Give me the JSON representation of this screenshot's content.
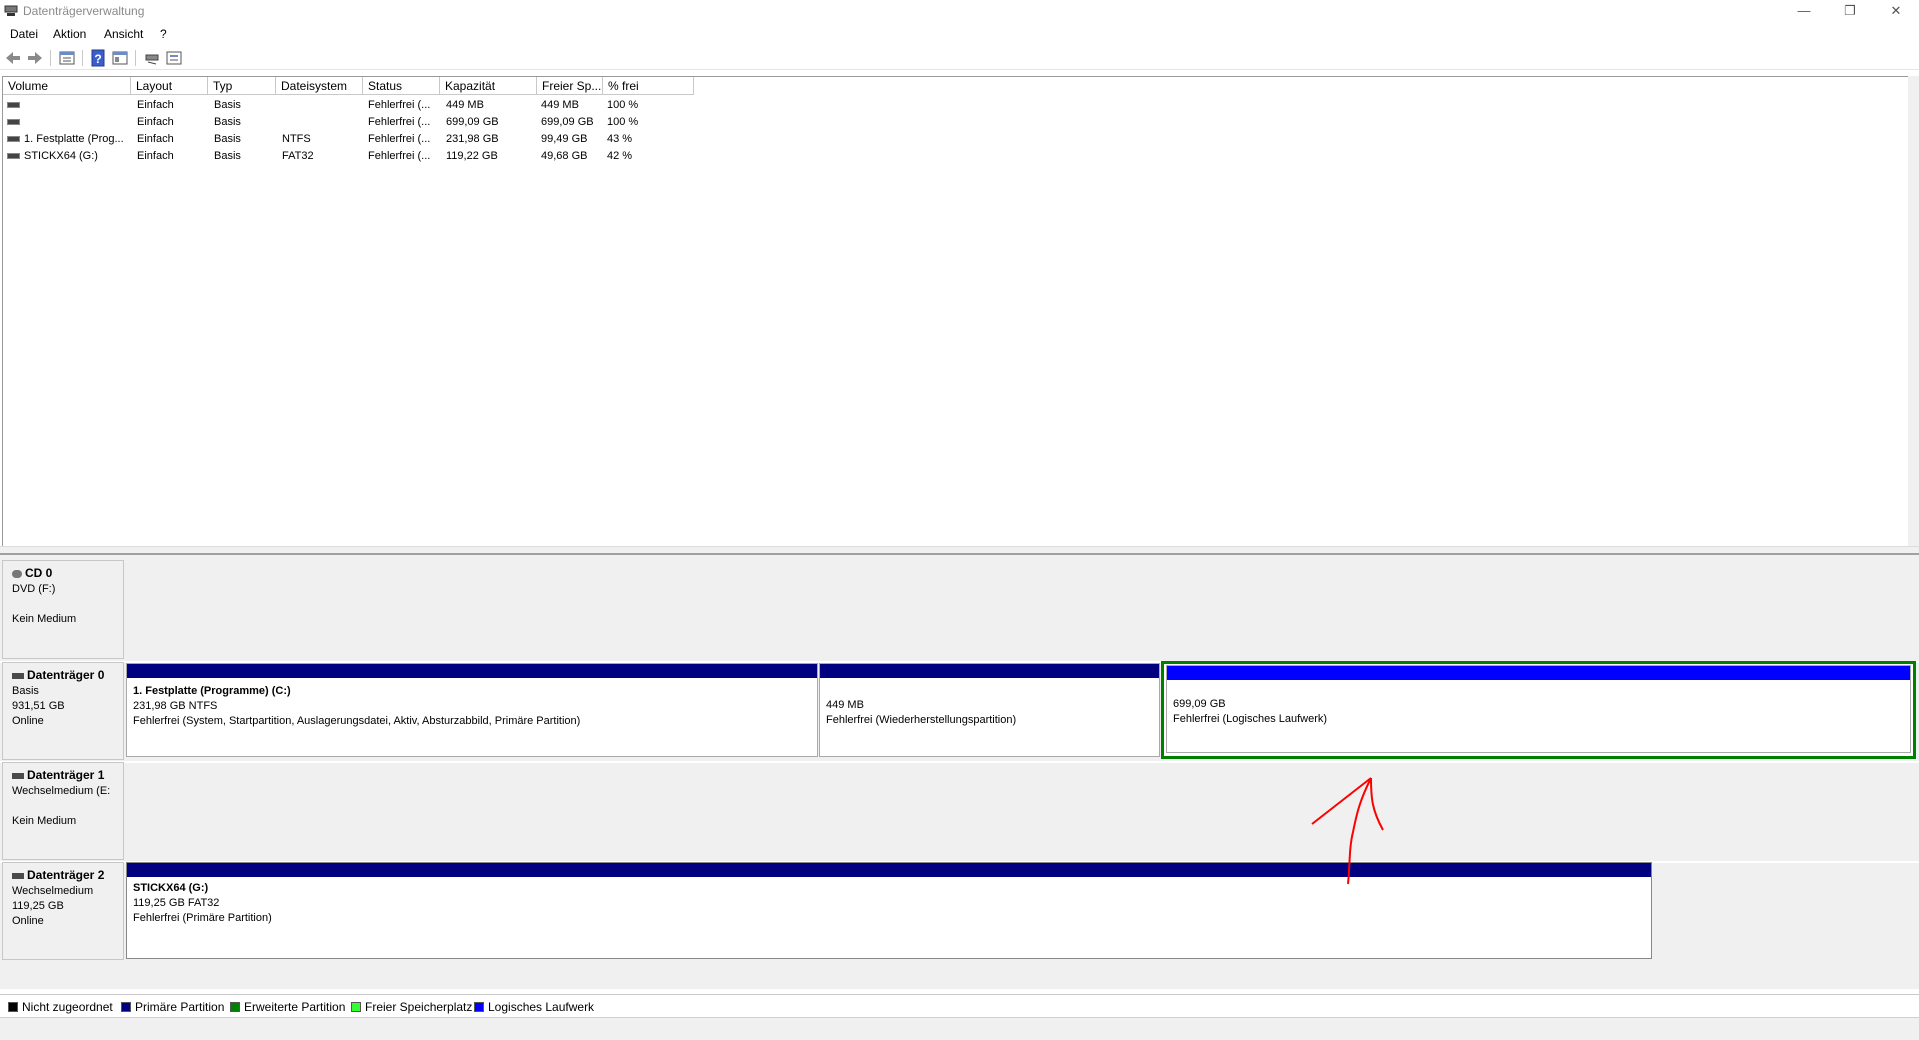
{
  "window": {
    "title": "Datenträgerverwaltung",
    "controls": {
      "minimize": "—",
      "restore": "❐",
      "close": "✕"
    }
  },
  "menu": {
    "items": [
      "Datei",
      "Aktion",
      "Ansicht",
      "?"
    ]
  },
  "toolbar": {
    "icons": [
      "back-arrow-icon",
      "forward-arrow-icon",
      "properties-icon",
      "help-icon",
      "view-icon",
      "connect-icon",
      "list-icon"
    ]
  },
  "volume_list": {
    "columns": [
      "Volume",
      "Layout",
      "Typ",
      "Dateisystem",
      "Status",
      "Kapazität",
      "Freier Sp...",
      "% frei"
    ],
    "rows": [
      [
        "",
        "Einfach",
        "Basis",
        "",
        "Fehlerfrei (...",
        "449 MB",
        "449 MB",
        "100 %"
      ],
      [
        "",
        "Einfach",
        "Basis",
        "",
        "Fehlerfrei (...",
        "699,09 GB",
        "699,09 GB",
        "100 %"
      ],
      [
        "1. Festplatte (Prog...",
        "Einfach",
        "Basis",
        "NTFS",
        "Fehlerfrei (...",
        "231,98 GB",
        "99,49 GB",
        "43 %"
      ],
      [
        "STICKX64 (G:)",
        "Einfach",
        "Basis",
        "FAT32",
        "Fehlerfrei (...",
        "119,22 GB",
        "49,68 GB",
        "42 %"
      ]
    ]
  },
  "disks": [
    {
      "name": "CD 0",
      "line1": "DVD (F:)",
      "line2": "",
      "line3": "Kein Medium"
    },
    {
      "name": "Datenträger 0",
      "line1": "Basis",
      "line2": "931,51 GB",
      "line3": "Online"
    },
    {
      "name": "Datenträger 1",
      "line1": "Wechselmedium (E:",
      "line2": "",
      "line3": "Kein Medium"
    },
    {
      "name": "Datenträger 2",
      "line1": "Wechselmedium",
      "line2": "119,25 GB",
      "line3": "Online"
    }
  ],
  "partitions": {
    "disk0_c": {
      "name": "1. Festplatte (Programme)  (C:)",
      "size": "231,98 GB NTFS",
      "status": "Fehlerfrei (System, Startpartition, Auslagerungsdatei, Aktiv, Absturzabbild, Primäre Partition)"
    },
    "disk0_recovery": {
      "size": "449 MB",
      "status": "Fehlerfrei (Wiederherstellungspartition)"
    },
    "disk0_logical": {
      "size": "699,09 GB",
      "status": "Fehlerfrei (Logisches Laufwerk)"
    },
    "disk2_g": {
      "name": "STICKX64  (G:)",
      "size": "119,25 GB FAT32",
      "status": "Fehlerfrei (Primäre Partition)"
    }
  },
  "legend": {
    "items": [
      {
        "label": "Nicht zugeordnet",
        "color": "#000000"
      },
      {
        "label": "Primäre Partition",
        "color": "#000080"
      },
      {
        "label": "Erweiterte Partition",
        "color": "#008000"
      },
      {
        "label": "Freier Speicherplatz",
        "color": "#33ff33"
      },
      {
        "label": "Logisches Laufwerk",
        "color": "#0000ff"
      }
    ]
  },
  "colors": {
    "primary": "#000080",
    "logical": "#0000ff",
    "extended": "#008000",
    "annotation": "#ff0000"
  }
}
